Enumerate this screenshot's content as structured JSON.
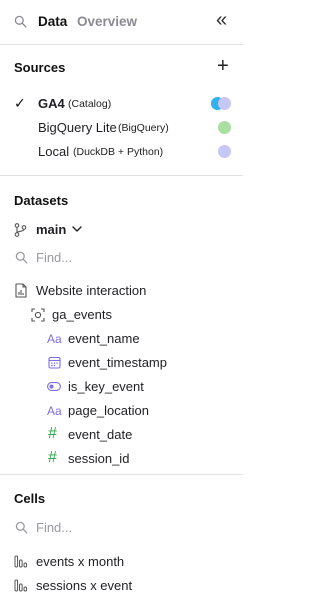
{
  "header": {
    "tabs": [
      {
        "label": "Data"
      },
      {
        "label": "Overview"
      }
    ]
  },
  "sources": {
    "title": "Sources",
    "items": [
      {
        "name": "GA4",
        "detail": "(Catalog)",
        "selected": true,
        "color": "#6aa8f7"
      },
      {
        "name": "BigQuery Lite",
        "detail": "(BigQuery)",
        "selected": false,
        "color": "#a9dfa0"
      },
      {
        "name": "Local",
        "detail": "(DuckDB + Python)",
        "selected": false,
        "color": "#c7c7f5"
      }
    ]
  },
  "datasets": {
    "title": "Datasets",
    "schema": "main",
    "search_placeholder": "Find...",
    "table_group": "Website interaction",
    "table": "ga_events",
    "columns": [
      {
        "name": "event_name",
        "type_icon": "text-type-icon"
      },
      {
        "name": "event_timestamp",
        "type_icon": "calendar-type-icon"
      },
      {
        "name": "is_key_event",
        "type_icon": "toggle-type-icon"
      },
      {
        "name": "page_location",
        "type_icon": "text-type-icon"
      },
      {
        "name": "event_date",
        "type_icon": "number-type-icon"
      },
      {
        "name": "session_id",
        "type_icon": "number-type-icon"
      }
    ]
  },
  "cells": {
    "title": "Cells",
    "search_placeholder": "Find...",
    "items": [
      {
        "label": "events x month"
      },
      {
        "label": "sessions x event"
      }
    ]
  },
  "icons": {
    "text_glyph": "Aa",
    "number_glyph": "#",
    "check_glyph": "✓",
    "add_glyph": "+",
    "collapse_glyph": "«"
  }
}
